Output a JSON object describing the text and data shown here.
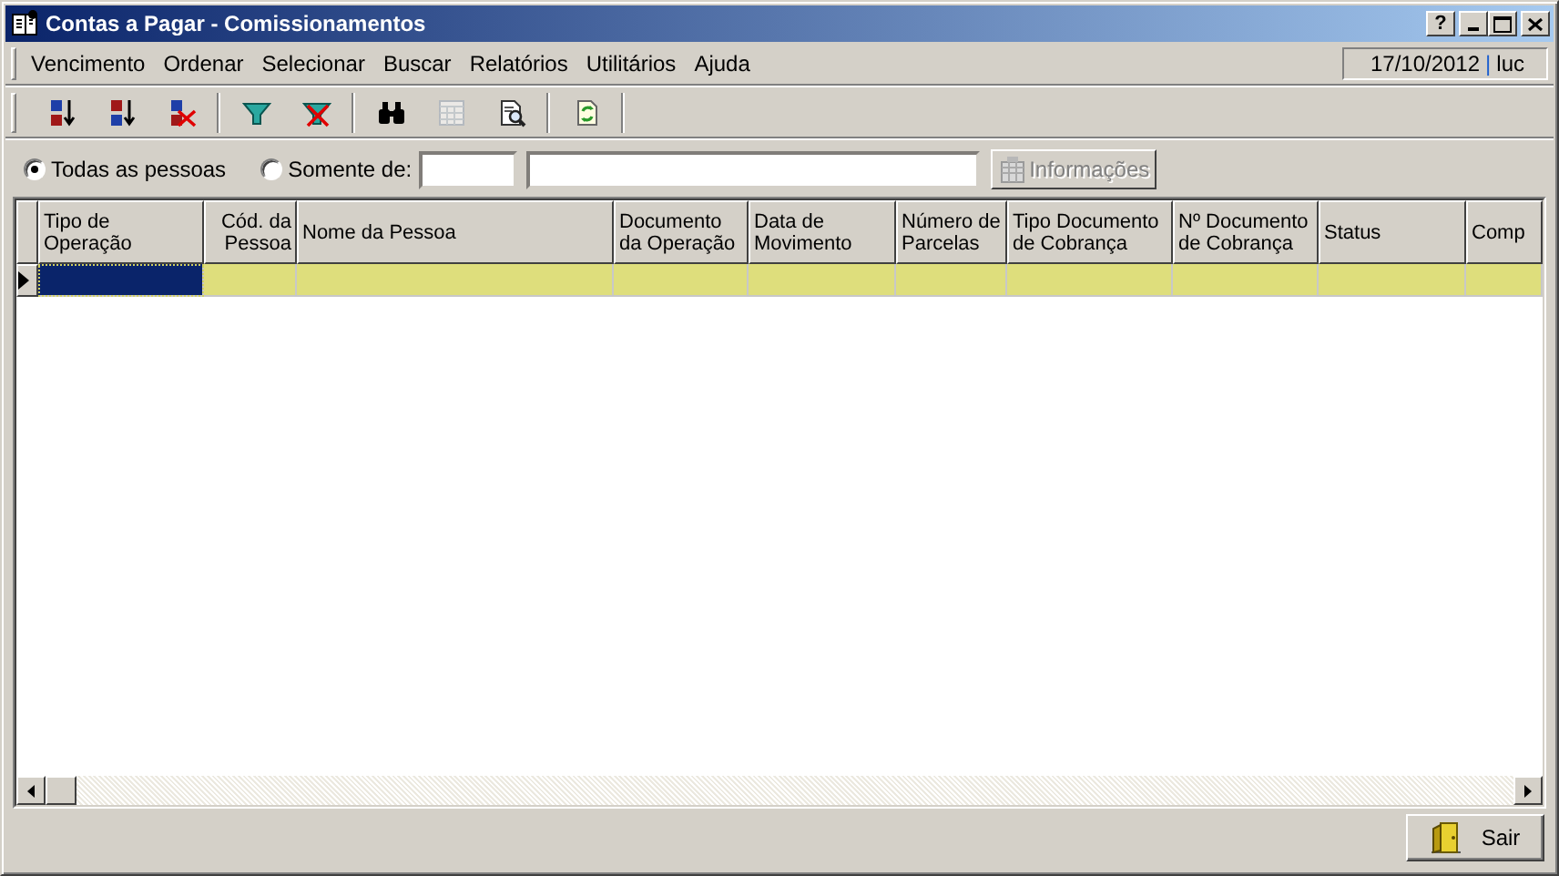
{
  "window": {
    "title": "Contas a Pagar - Comissionamentos",
    "help_button": "?"
  },
  "menu": [
    {
      "label": "Vencimento"
    },
    {
      "label": "Ordenar"
    },
    {
      "label": "Selecionar"
    },
    {
      "label": "Buscar"
    },
    {
      "label": "Relatórios"
    },
    {
      "label": "Utilitários"
    },
    {
      "label": "Ajuda"
    }
  ],
  "session": {
    "date": "17/10/2012",
    "separator": "|",
    "user": "luc"
  },
  "toolbar": [
    {
      "kind": "sort-asc",
      "disabled": false
    },
    {
      "kind": "sort-desc",
      "disabled": false
    },
    {
      "kind": "sort-clear",
      "disabled": false
    },
    {
      "kind": "filter",
      "disabled": false
    },
    {
      "kind": "filter-clear",
      "disabled": false
    },
    {
      "kind": "find",
      "disabled": false
    },
    {
      "kind": "grid",
      "disabled": true
    },
    {
      "kind": "preview",
      "disabled": false
    },
    {
      "kind": "refresh",
      "disabled": false
    }
  ],
  "filter": {
    "options": [
      {
        "label": "Todas as pessoas",
        "selected": true
      },
      {
        "label": "Somente de:",
        "selected": false
      }
    ],
    "info_button": {
      "label": "Informações",
      "disabled": true
    }
  },
  "grid": {
    "columns": [
      {
        "label": "Tipo de Operação",
        "kind": "text"
      },
      {
        "label": "Cód. da Pessoa",
        "kind": "number"
      },
      {
        "label": "Nome da Pessoa",
        "kind": "text"
      },
      {
        "label": "Documento da Operação",
        "kind": "text"
      },
      {
        "label": "Data de Movimento",
        "kind": "text"
      },
      {
        "label": "Número de Parcelas",
        "kind": "text"
      },
      {
        "label": "Tipo Documento de Cobrança",
        "kind": "text"
      },
      {
        "label": "Nº Documento de Cobrança",
        "kind": "text"
      },
      {
        "label": "Status",
        "kind": "text"
      },
      {
        "label": "Comp",
        "kind": "text"
      }
    ],
    "rows": [
      {
        "selected": true,
        "cells": [
          {
            "focused": true
          },
          {
            "focused": false
          },
          {
            "focused": false
          },
          {
            "focused": false
          },
          {
            "focused": false
          },
          {
            "focused": false
          },
          {
            "focused": false
          },
          {
            "focused": false
          },
          {
            "focused": false
          },
          {
            "focused": false
          }
        ]
      }
    ]
  },
  "footer": {
    "exit_button": "Sair"
  }
}
